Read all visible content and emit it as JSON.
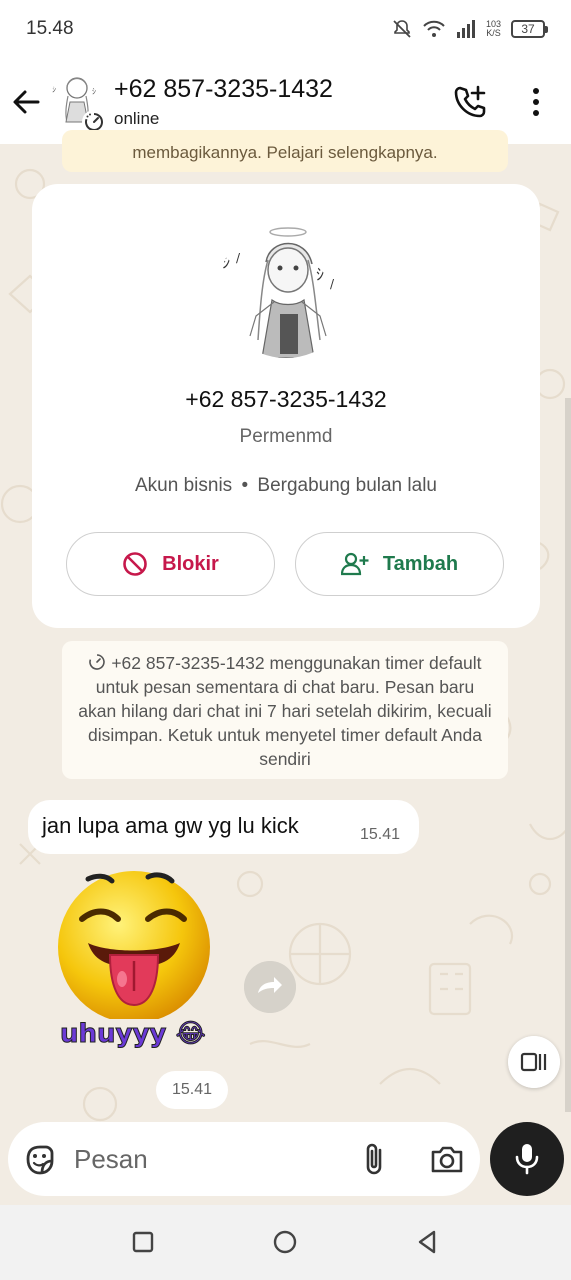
{
  "status_bar": {
    "time": "15.48",
    "net_speed_value": "103",
    "net_speed_unit": "K/S",
    "battery": "37"
  },
  "header": {
    "contact_number": "+62 857-3235-1432",
    "status": "online"
  },
  "banner": {
    "text": "membagikannya. Pelajari selengkapnya."
  },
  "profile_card": {
    "number": "+62 857-3235-1432",
    "name": "Permenmd",
    "account_type": "Akun bisnis",
    "separator": "•",
    "joined": "Bergabung bulan lalu",
    "block_label": "Blokir",
    "add_label": "Tambah"
  },
  "system_message": {
    "text": "+62 857-3235-1432 menggunakan timer default untuk pesan sementara di chat baru. Pesan baru akan hilang dari chat ini 7 hari setelah dikirim, kecuali disimpan. Ketuk untuk menyetel timer default Anda sendiri"
  },
  "messages": [
    {
      "text": "jan lupa ama gw yg lu kick",
      "time": "15.41"
    },
    {
      "sticker_caption": "uhuyyy",
      "sticker_emoji": "😂",
      "time": "15.41"
    }
  ],
  "composer": {
    "placeholder": "Pesan"
  },
  "colors": {
    "block_red": "#c6184b",
    "add_green": "#1f7a4d",
    "wallpaper": "#f2ece3",
    "mic_button": "#1f1f1f"
  },
  "icons": {
    "back": "back-arrow-icon",
    "add_call": "add-call-icon",
    "menu": "more-vert-icon",
    "block": "block-icon",
    "add_contact": "person-add-icon",
    "timer": "disappearing-timer-icon",
    "forward": "forward-icon",
    "emoji": "sticker-icon",
    "attach": "paperclip-icon",
    "camera": "camera-icon",
    "mic": "microphone-icon"
  }
}
